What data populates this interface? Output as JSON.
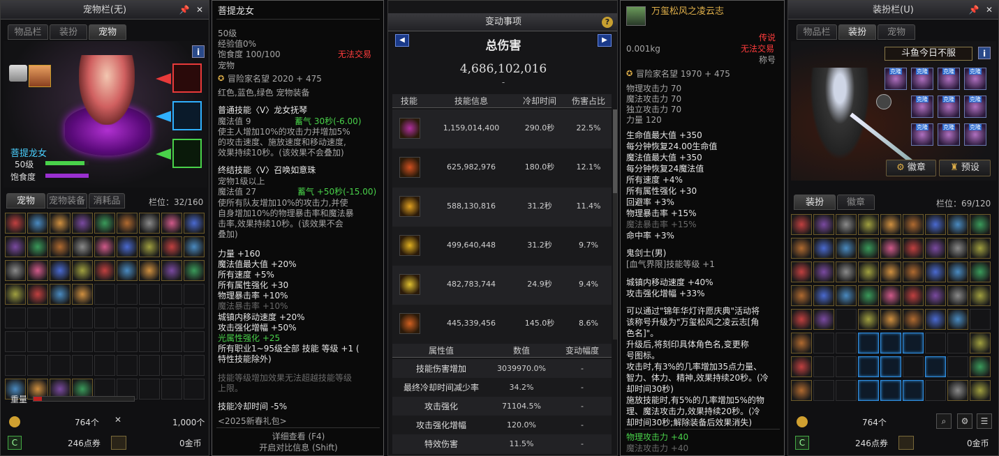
{
  "pet": {
    "title": "宠物栏(无)",
    "pin": "📌",
    "close": "✕",
    "tabs": [
      "物品栏",
      "装扮",
      "宠物"
    ],
    "info": "i",
    "name": "菩提龙女",
    "level": "50级",
    "hunger_label": "饱食度",
    "level_fill": 0.9,
    "hunger_fill": 1.0,
    "lower_tabs": [
      "宠物",
      "宠物装备",
      "消耗品"
    ],
    "slots_label": "栏位：32/160",
    "weight_label": "重量",
    "gold": "764个",
    "coins": "1,000个",
    "points": "246点券",
    "money": "0金币",
    "colors": {
      "blue_tag": "#2fb0ff",
      "red_tag": "#e83a3a",
      "green_tag": "#49d24a"
    }
  },
  "tip1": {
    "name": "菩提龙女",
    "level": "50级",
    "exp": "经验值0%",
    "hunger": "饱食度 100/100",
    "notrade": "无法交易",
    "pet": "宠物",
    "fame": "冒险家名望 2020 + 475",
    "colors_line": "红色,蓝色,绿色 宠物装备",
    "s1_title": "普通技能〈V〉龙女抚琴",
    "s1_mp": "魔法值 9",
    "s1_cd": "蓄气 30秒(-6.00)",
    "s1_desc": [
      "使主人增加10%的攻击力并增加5%",
      "的攻击速度、施放速度和移动速度,",
      "效果持续10秒。(该效果不会叠加)"
    ],
    "s2_title": "终结技能〈V〉召唤如意珠",
    "s2_req": "宠物1级以上",
    "s2_mp": "魔法值 27",
    "s2_cd": "蓄气 +50秒(-15.00)",
    "s2_desc": [
      "使所有队友增加10%的攻击力,并使",
      "自身增加10%的物理暴击率和魔法暴",
      "击率,效果持续10秒。(该效果不会",
      "叠加)"
    ],
    "stats": [
      "力量 +160",
      "魔法值最大值 +20%",
      "所有速度 +5%",
      "所有属性强化 +30",
      "物理暴击率 +10%"
    ],
    "stat_gray": "魔法暴击率 +10%",
    "stats2": [
      "城镇内移动速度 +20%",
      "攻击强化增幅 +50%"
    ],
    "light": "光属性强化 +25",
    "alljob": [
      "所有职业1~95级全部 技能 等级 +1 (",
      "特性技能除外)"
    ],
    "note": [
      "技能等级增加效果无法超越技能等级",
      "上限。"
    ],
    "cdr": "技能冷却时间 -5%",
    "bag": "<2025新春礼包>",
    "f4": "详细查看 (F4)",
    "shift": "开启对比信息 (Shift)"
  },
  "dmg": {
    "header": "变动事项",
    "help": "?",
    "title": "总伤害",
    "total": "4,686,102,016",
    "sub": "-",
    "cols": [
      "技能",
      "技能信息",
      "冷却时间",
      "伤害占比"
    ],
    "rows": [
      {
        "v": "1,159,014,400",
        "cd": "290.0秒",
        "p": "22.5%"
      },
      {
        "v": "625,982,976",
        "cd": "180.0秒",
        "p": "12.1%"
      },
      {
        "v": "588,130,816",
        "cd": "31.2秒",
        "p": "11.4%"
      },
      {
        "v": "499,640,448",
        "cd": "31.2秒",
        "p": "9.7%"
      },
      {
        "v": "482,783,744",
        "cd": "24.9秒",
        "p": "9.4%"
      },
      {
        "v": "445,339,456",
        "cd": "145.0秒",
        "p": "8.6%"
      }
    ],
    "attr_cols": [
      "属性值",
      "数值",
      "变动幅度"
    ],
    "attrs": [
      {
        "k": "技能伤害增加",
        "v": "3039970.0%",
        "d": "-"
      },
      {
        "k": "最终冷却时间减少率",
        "v": "34.2%",
        "d": "-"
      },
      {
        "k": "攻击强化",
        "v": "71104.5%",
        "d": "-"
      },
      {
        "k": "攻击强化增幅",
        "v": "120.0%",
        "d": "-"
      },
      {
        "k": "特效伤害",
        "v": "11.5%",
        "d": "-"
      }
    ]
  },
  "tip2": {
    "name": "万玺松风之凌云志",
    "weight": "0.001kg",
    "rarity": "传说",
    "notrade": "无法交易",
    "type": "称号",
    "fame": "冒险家名望 1970 + 475",
    "gstats": [
      "物理攻击力 70",
      "魔法攻击力 70",
      "独立攻击力 70",
      "力量 120"
    ],
    "wstats": [
      "生命值最大值 +350",
      "每分钟恢复24.00生命值",
      "魔法值最大值 +350",
      "每分钟恢复24魔法值",
      "所有速度 +4%",
      "所有属性强化 +30",
      "回避率 +3%",
      "物理暴击率 +15%"
    ],
    "mcrit": "魔法暴击率 +15%",
    "hit": "命中率 +3%",
    "cls": "鬼剑士(男)",
    "cls_skill": "[血气界限]技能等级 +1",
    "town": [
      "城镇内移动速度 +40%",
      "攻击强化增幅 +33%"
    ],
    "desc": [
      "可以通过\"锦年华灯许愿庆典\"活动将",
      "该称号升级为\"万玺松风之凌云志[角",
      "色名]\"。",
      "升级后,将刻印具体角色名,变更称",
      "号图标。",
      "攻击时,有3%的几率增加35点力量、",
      "智力、体力、精神,效果持续20秒。(冷",
      "却时间30秒)",
      "施放技能时,有5%的几率增加5%的物",
      "理、魔法攻击力,效果持续20秒。(冷",
      "却时间30秒;解除装备后效果消失)"
    ],
    "g1": "物理攻击力 +40",
    "g2": "魔法攻击力 +40"
  },
  "avatar": {
    "title": "装扮栏(U)",
    "pin": "📌",
    "close": "✕",
    "tabs": [
      "物品栏",
      "装扮",
      "宠物"
    ],
    "nick": "斗鱼今日不服",
    "info": "i",
    "badge_btn": "徽章",
    "preset_btn": "预设",
    "lower_tabs": [
      "装扮",
      "徽章"
    ],
    "slots_label": "栏位：69/120",
    "gold": "764个",
    "points": "246点券",
    "money": "0金币",
    "slot_tag": "克隆"
  }
}
